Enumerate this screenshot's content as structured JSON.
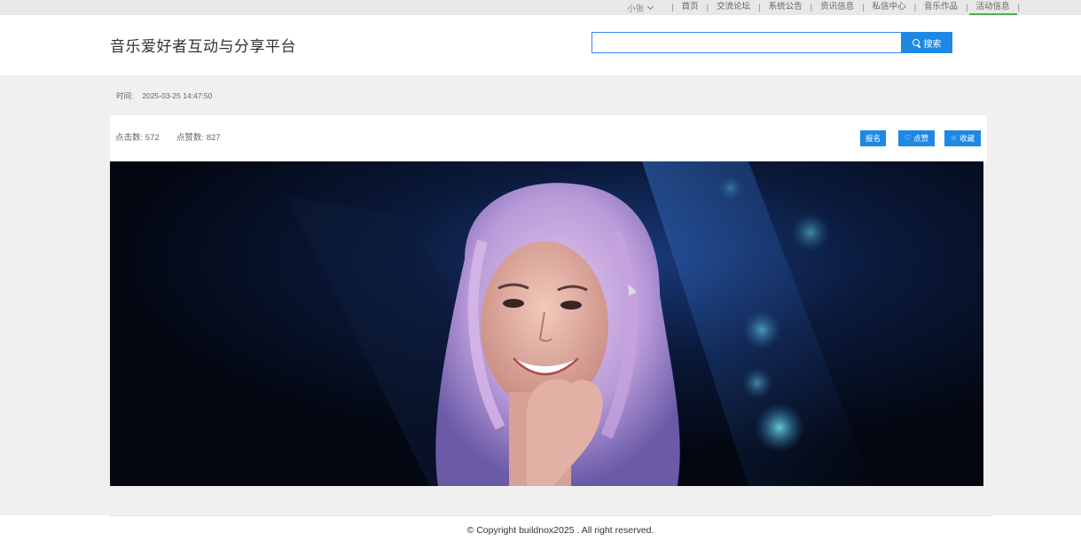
{
  "topnav": {
    "user": "小张",
    "links": [
      "首页",
      "交流论坛",
      "系统公告",
      "资讯信息",
      "私信中心",
      "音乐作品",
      "活动信息"
    ],
    "active_index": 6
  },
  "header": {
    "title": "音乐爱好者互动与分享平台",
    "search_value": "",
    "search_button": "搜索"
  },
  "detail": {
    "time_label": "时间:",
    "time_value": "2025-03-25 14:47:50",
    "clicks_label": "点击数:",
    "clicks_value": "572",
    "likes_label": "点赞数:",
    "likes_value": "827",
    "signup_button": "报名",
    "like_button": "点赞",
    "favorite_button": "收藏"
  },
  "footer": {
    "copyright": "© Copyright buildnox2025 . All right reserved."
  },
  "colors": {
    "accent": "#1e88e5",
    "active_underline": "#4caf50"
  }
}
